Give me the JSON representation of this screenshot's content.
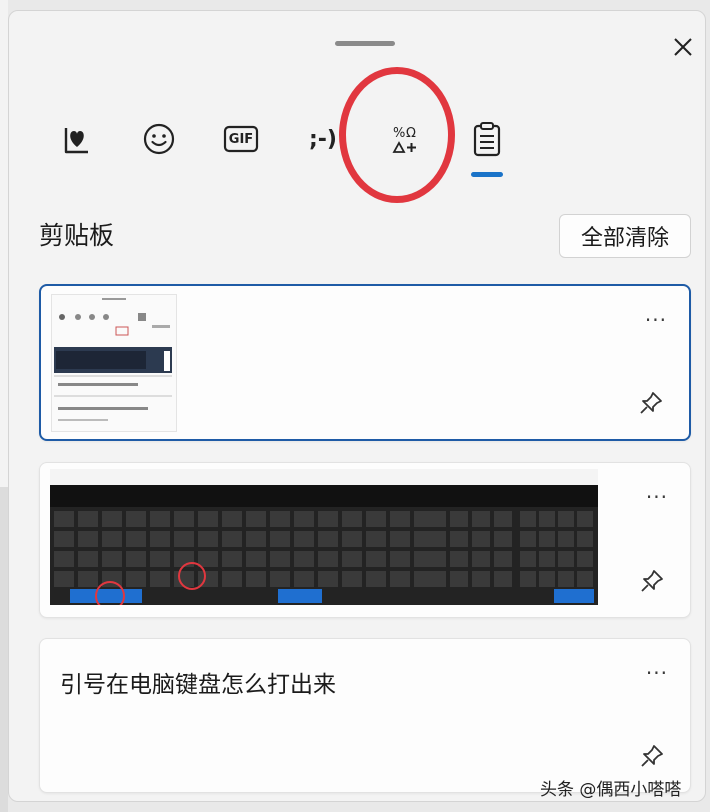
{
  "panel": {
    "close_label": "✕"
  },
  "tabs": [
    {
      "name": "favorites",
      "icon": "heart-box-icon"
    },
    {
      "name": "emoji",
      "icon": "smiley-icon"
    },
    {
      "name": "gif",
      "icon": "gif-icon",
      "label": "GIF"
    },
    {
      "name": "kaomoji",
      "icon": "kaomoji-icon",
      "label": ";-)"
    },
    {
      "name": "symbols",
      "icon": "symbols-icon",
      "label": "%Ω△+"
    },
    {
      "name": "clipboard",
      "icon": "clipboard-icon",
      "active": true
    }
  ],
  "clipboard": {
    "title": "剪贴板",
    "clear_all_label": "全部清除",
    "items": [
      {
        "type": "image",
        "description_icon": "screenshot-thumbnail",
        "selected": true,
        "more_label": "···"
      },
      {
        "type": "image",
        "description_icon": "keyboard-thumbnail",
        "more_label": "···"
      },
      {
        "type": "text",
        "text": "引号在电脑键盘怎么打出来",
        "more_label": "···"
      }
    ]
  },
  "watermark": "头条 @偶西小嗒嗒",
  "colors": {
    "accent": "#1a73c8",
    "selected_border": "#1e5ba6",
    "highlight_circle": "#e1373f"
  }
}
